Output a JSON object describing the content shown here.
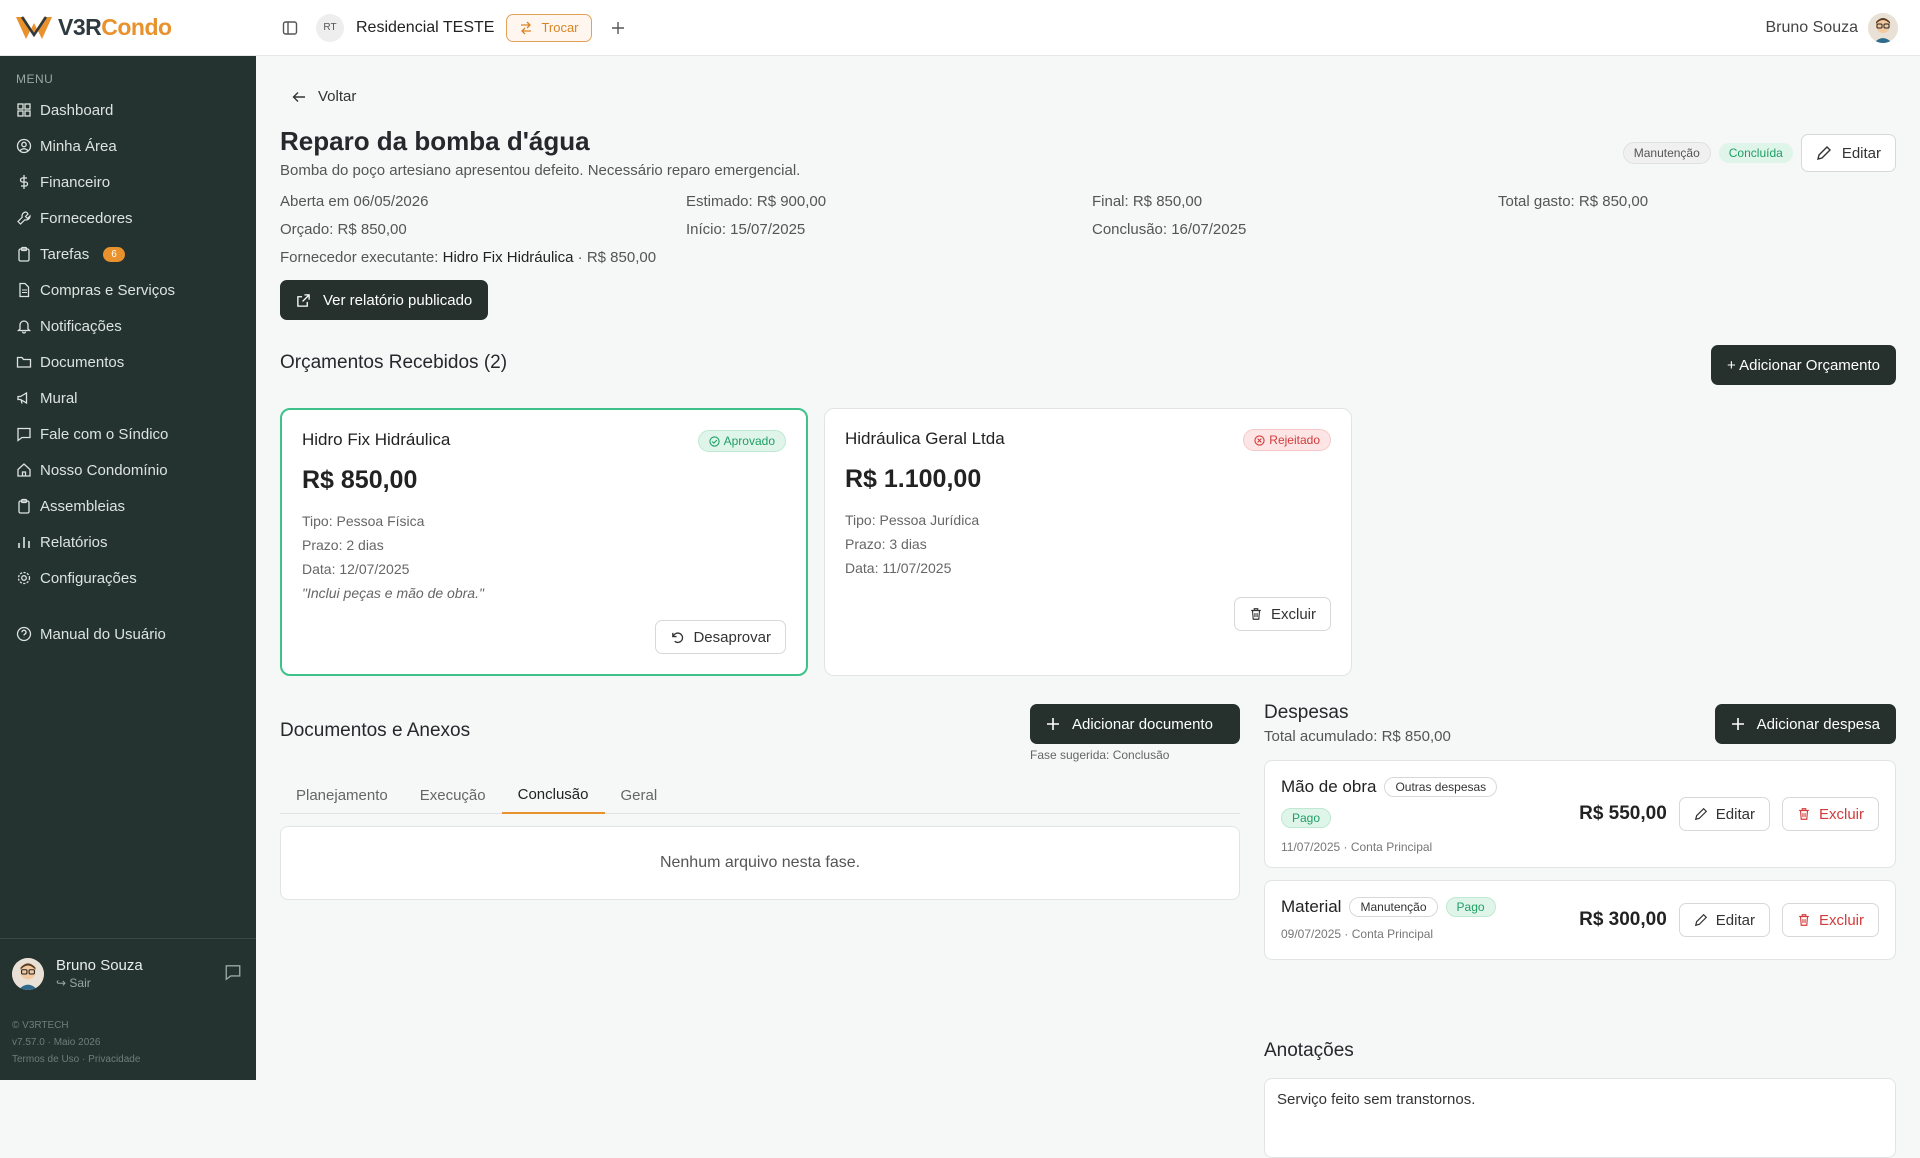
{
  "brand": {
    "logo_main": "V3R",
    "logo_accent": "Condo",
    "accent_color": "#e8912d",
    "sidebar_color": "#24332f"
  },
  "topbar": {
    "condo_initials": "RT",
    "condo_name": "Residencial TESTE",
    "switch_label": "Trocar",
    "user_name": "Bruno Souza"
  },
  "sidebar": {
    "menu_title": "MENU",
    "items": [
      {
        "label": "Dashboard",
        "icon": "dashboard-icon"
      },
      {
        "label": "Minha Área",
        "icon": "user-circle-icon"
      },
      {
        "label": "Financeiro",
        "icon": "dollar-icon"
      },
      {
        "label": "Fornecedores",
        "icon": "wrench-icon"
      },
      {
        "label": "Tarefas",
        "icon": "clipboard-icon",
        "badge": "6"
      },
      {
        "label": "Compras e Serviços",
        "icon": "file-icon"
      },
      {
        "label": "Notificações",
        "icon": "bell-icon"
      },
      {
        "label": "Documentos",
        "icon": "folder-icon"
      },
      {
        "label": "Mural",
        "icon": "megaphone-icon"
      },
      {
        "label": "Fale com o Síndico",
        "icon": "chat-icon"
      },
      {
        "label": "Nosso Condomínio",
        "icon": "home-icon"
      },
      {
        "label": "Assembleias",
        "icon": "clipboard-icon"
      },
      {
        "label": "Relatórios",
        "icon": "bar-chart-icon"
      },
      {
        "label": "Configurações",
        "icon": "gear-icon"
      }
    ],
    "manual_label": "Manual do Usuário",
    "user_name": "Bruno Souza",
    "logout_label": "Sair",
    "footer_company": "© V3RTECH",
    "footer_version": "v7.57.0 · Maio 2026",
    "footer_terms": "Termos de Uso",
    "footer_sep": "·",
    "footer_privacy": "Privacidade"
  },
  "page": {
    "back_label": "Voltar",
    "title": "Reparo da bomba d'água",
    "description": "Bomba do poço artesiano apresentou defeito. Necessário reparo emergencial.",
    "tag_category": "Manutenção",
    "tag_status": "Concluída",
    "edit_label": "Editar",
    "info": {
      "opened": "Aberta em 06/05/2026",
      "estimated": "Estimado: R$ 900,00",
      "final": "Final: R$ 850,00",
      "total_spent": "Total gasto: R$ 850,00",
      "budgeted": "Orçado: R$ 850,00",
      "start": "Início: 15/07/2025",
      "conclusion": "Conclusão: 16/07/2025",
      "supplier_label": "Fornecedor executante:",
      "supplier_name": "Hidro Fix Hidráulica",
      "supplier_value": "· R$ 850,00"
    },
    "report_button": "Ver relatório publicado"
  },
  "quotes": {
    "title": "Orçamentos Recebidos (2)",
    "add_label": "+ Adicionar Orçamento",
    "items": [
      {
        "name": "Hidro Fix Hidráulica",
        "status": "Aprovado",
        "value": "R$ 850,00",
        "type": "Tipo: Pessoa Física",
        "deadline": "Prazo: 2 dias",
        "date": "Data: 12/07/2025",
        "note": "\"Inclui peças e mão de obra.\"",
        "action": "Desaprovar"
      },
      {
        "name": "Hidráulica Geral Ltda",
        "status": "Rejeitado",
        "value": "R$ 1.100,00",
        "type": "Tipo: Pessoa Jurídica",
        "deadline": "Prazo: 3 dias",
        "date": "Data: 11/07/2025",
        "action": "Excluir"
      }
    ]
  },
  "documents": {
    "title": "Documentos e Anexos",
    "add_label": "Adicionar documento",
    "phase_hint": "Fase sugerida: Conclusão",
    "tabs": [
      "Planejamento",
      "Execução",
      "Conclusão",
      "Geral"
    ],
    "active_tab": "Conclusão",
    "empty_text": "Nenhum arquivo nesta fase."
  },
  "expenses": {
    "title": "Despesas",
    "total": "Total acumulado: R$ 850,00",
    "add_label": "Adicionar despesa",
    "items": [
      {
        "name": "Mão de obra",
        "category": "Outras despesas",
        "status": "Pago",
        "meta": "11/07/2025 · Conta Principal",
        "amount": "R$ 550,00",
        "edit": "Editar",
        "delete": "Excluir"
      },
      {
        "name": "Material",
        "category": "Manutenção",
        "status": "Pago",
        "meta": "09/07/2025 · Conta Principal",
        "amount": "R$ 300,00",
        "edit": "Editar",
        "delete": "Excluir"
      }
    ]
  },
  "notes": {
    "title": "Anotações",
    "text": "Serviço feito sem transtornos."
  }
}
